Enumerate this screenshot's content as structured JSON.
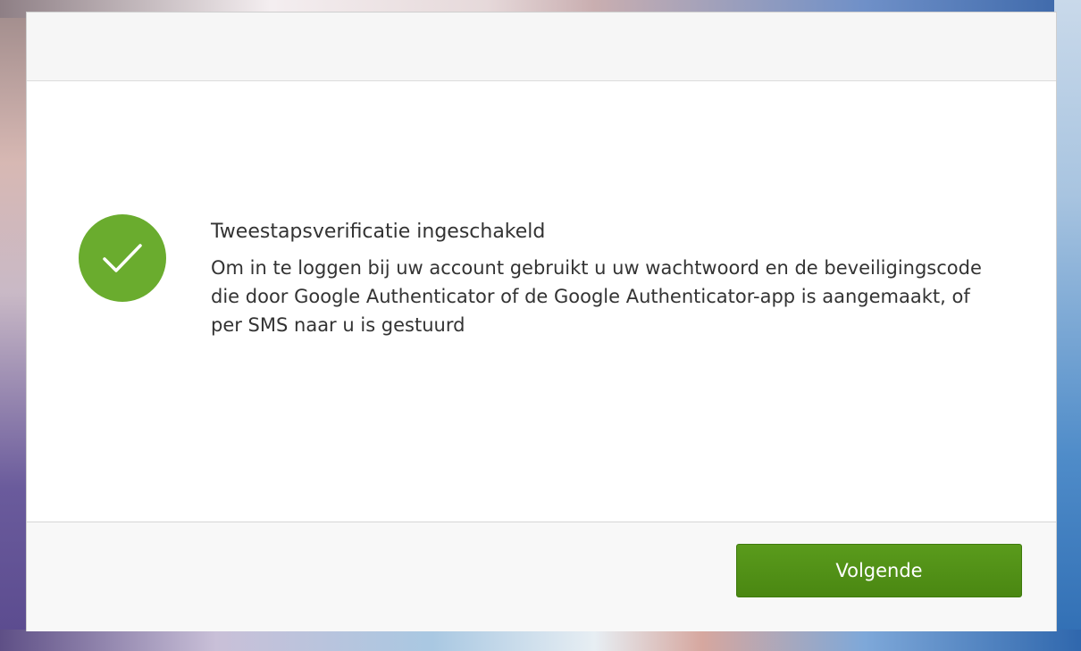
{
  "dialog": {
    "status_icon": "check-circle-icon",
    "title": "Tweestapsverificatie ingeschakeld",
    "description": "Om in te loggen bij uw account gebruikt u uw wachtwoord en de beveiligingscode die door Google Authenticator of de Google Authenticator-app is aangemaakt, of per SMS naar u is gestuurd",
    "next_button_label": "Volgende"
  },
  "colors": {
    "success_green": "#6aac2e",
    "button_green": "#4a8712",
    "text": "#333333"
  }
}
